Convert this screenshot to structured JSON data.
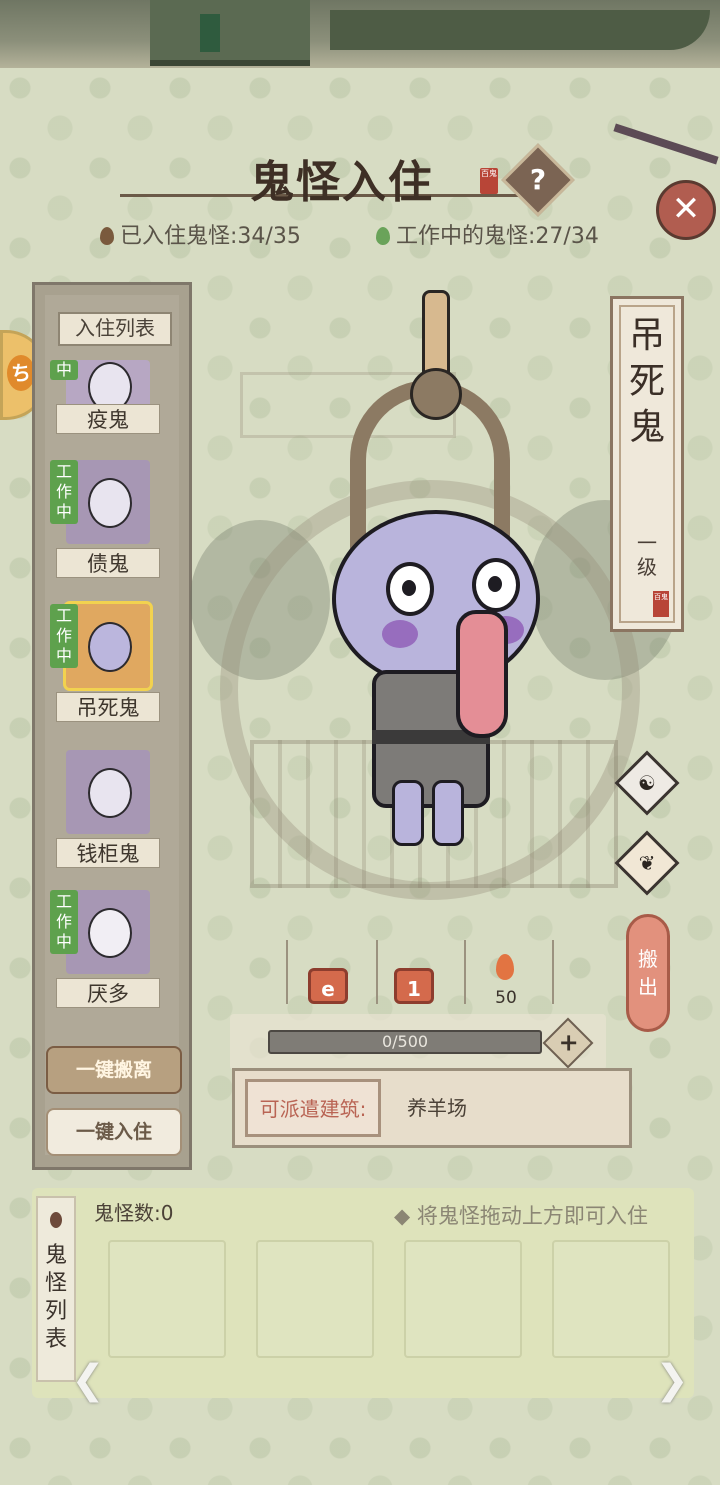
{
  "header": {
    "title": "鬼怪入住",
    "title_seal": "百鬼",
    "help_label": "?",
    "close_label": "✕",
    "resident_stat": "已入住鬼怪:34/35",
    "working_stat": "工作中的鬼怪:27/34"
  },
  "left_panel": {
    "title": "入住列表",
    "side_tab_glyph": "ち",
    "entries": [
      {
        "name": "疫鬼",
        "working": "中"
      },
      {
        "name": "债鬼",
        "working": "工作中"
      },
      {
        "name": "吊死鬼",
        "working": "工作中",
        "selected": true
      },
      {
        "name": "钱柜鬼",
        "working": ""
      },
      {
        "name": "厌多",
        "working": "工作中"
      }
    ],
    "remove_all": "一键搬离",
    "add_all": "一键入住"
  },
  "detail": {
    "ghost_name": "吊死鬼",
    "level": "一级",
    "stamp": "百鬼",
    "flame_value": "50",
    "icon_1": "e",
    "icon_2": "1",
    "xp_text": "0/500",
    "xp_fraction": 0,
    "plus_label": "+",
    "move_label": "搬出",
    "dispatch_label": "可派遣建筑:",
    "dispatch_value": "养羊场"
  },
  "bottom": {
    "tab_label": "鬼怪列表",
    "count": "鬼怪数:0",
    "hint": "◆ 将鬼怪拖动上方即可入住",
    "prev_arrow": "❮",
    "next_arrow": "❯"
  },
  "icons": {
    "stats_resident": "drop-icon-brown",
    "stats_working": "drop-icon-green",
    "diamond_1": "ghost-flame-icon",
    "diamond_2": "peach-icon"
  },
  "colors": {
    "accent_red": "#b84537",
    "work_green": "#5ea14d",
    "move_btn": "#e2917d"
  }
}
